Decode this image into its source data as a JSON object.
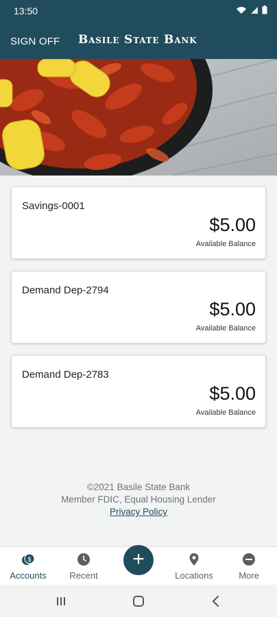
{
  "status_bar": {
    "time": "13:50"
  },
  "header": {
    "sign_off_label": "SIGN OFF",
    "bank_name": "Basile State Bank"
  },
  "accounts": [
    {
      "name": "Savings-0001",
      "balance": "$5.00",
      "balance_label": "Available Balance"
    },
    {
      "name": "Demand Dep-2794",
      "balance": "$5.00",
      "balance_label": "Available Balance"
    },
    {
      "name": "Demand Dep-2783",
      "balance": "$5.00",
      "balance_label": "Available Balance"
    }
  ],
  "footer": {
    "copyright": "©2021 Basile State Bank",
    "member": "Member FDIC, Equal Housing Lender",
    "privacy": "Privacy Policy"
  },
  "bottom_nav": [
    {
      "label": "Accounts",
      "icon": "accounts-icon",
      "active": true
    },
    {
      "label": "Recent",
      "icon": "clock-icon",
      "active": false
    },
    {
      "label": "",
      "icon": "plus-icon",
      "active": false
    },
    {
      "label": "Locations",
      "icon": "location-pin-icon",
      "active": false
    },
    {
      "label": "More",
      "icon": "more-icon",
      "active": false
    }
  ],
  "colors": {
    "primary": "#214c5e",
    "background": "#f2f3f3",
    "card": "#ffffff",
    "footer_text": "#6f7478"
  }
}
